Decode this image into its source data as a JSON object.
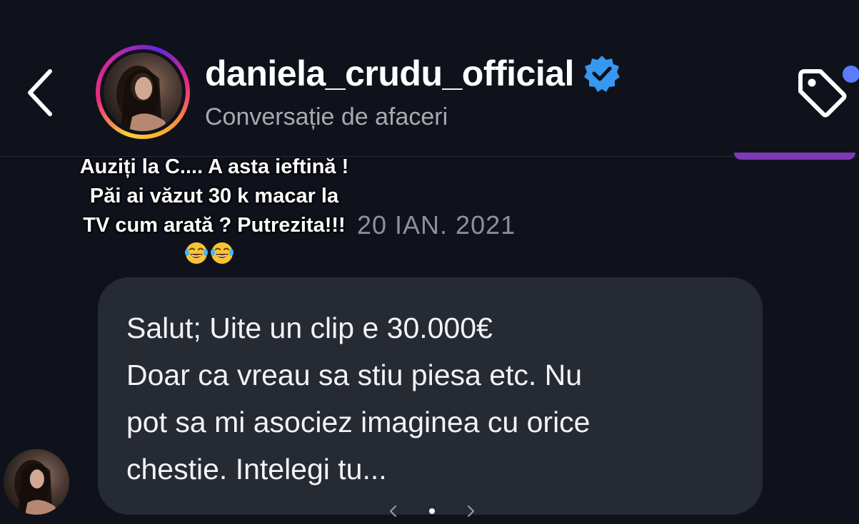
{
  "header": {
    "username": "daniela_crudu_official",
    "subtitle": "Conversație de afaceri",
    "verified": true,
    "notification_dot_color": "#5b7cff"
  },
  "thread": {
    "date_separator": "20 IAN. 2021",
    "message": {
      "lines": [
        "Salut; Uite un clip e 30.000€",
        "Doar ca vreau sa stiu piesa etc. Nu",
        "pot sa mi asociez imaginea cu orice",
        "chestie. Intelegi tu..."
      ]
    }
  },
  "overlay_caption": {
    "lines": [
      "Auziți la C.... A asta ieftină !",
      "Păi ai văzut 30 k macar la",
      "TV cum arată ? Putrezita!!!"
    ],
    "emojis": [
      "laughing-tears-emoji",
      "laughing-tears-emoji"
    ]
  },
  "icons": {
    "back": "chevron-left-icon",
    "tag": "tag-icon",
    "verified": "verified-badge-icon"
  },
  "colors": {
    "background": "#0f121b",
    "bubble": "#262a33",
    "verified_blue": "#3897f0",
    "story_ring": [
      "#f9ce34",
      "#ee2a7b",
      "#6228d7"
    ]
  }
}
